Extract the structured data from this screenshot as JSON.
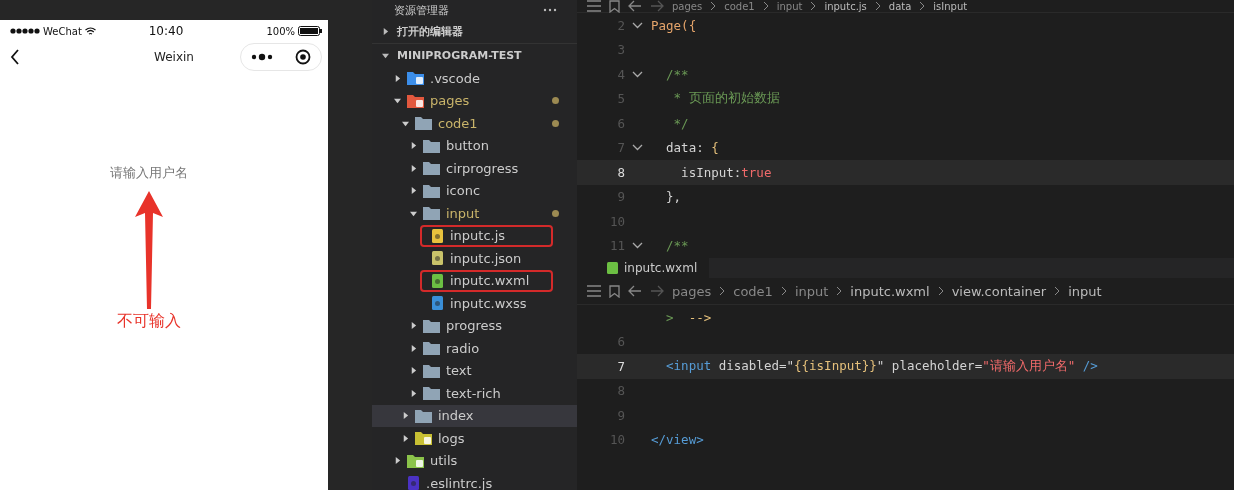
{
  "phone": {
    "status_bar": {
      "carrier": "WeChat",
      "time": "10:40",
      "battery": "100%"
    },
    "nav_bar": {
      "title": "Weixin"
    },
    "input": {
      "placeholder": "请输入用户名",
      "disabled": true
    },
    "annotation": "不可输入"
  },
  "explorer": {
    "title": "资源管理器",
    "sections": [
      {
        "label": "打开的编辑器",
        "expanded": false
      },
      {
        "label": "MINIPROGRAM-TEST",
        "expanded": true
      }
    ],
    "tree": [
      {
        "label": ".vscode",
        "kind": "vscode",
        "expanded": false,
        "modified": false,
        "selected": false
      },
      {
        "label": "pages",
        "kind": "pages",
        "expanded": true,
        "modified": true,
        "selected": false,
        "children": [
          {
            "label": "code1",
            "kind": "folder",
            "expanded": true,
            "modified": true,
            "selected": false,
            "children": [
              {
                "label": "button",
                "kind": "folder",
                "expanded": false,
                "modified": false,
                "selected": false
              },
              {
                "label": "cirprogress",
                "kind": "folder",
                "expanded": false,
                "modified": false,
                "selected": false
              },
              {
                "label": "iconc",
                "kind": "folder",
                "expanded": false,
                "modified": false,
                "selected": false
              },
              {
                "label": "input",
                "kind": "folder",
                "expanded": true,
                "modified": true,
                "selected": false,
                "children": [
                  {
                    "label": "inputc.js",
                    "kind": "js",
                    "boxed": true,
                    "modified": false,
                    "selected": false
                  },
                  {
                    "label": "inputc.json",
                    "kind": "json",
                    "boxed": false,
                    "modified": false,
                    "selected": false
                  },
                  {
                    "label": "inputc.wxml",
                    "kind": "wxml",
                    "boxed": true,
                    "modified": false,
                    "selected": false
                  },
                  {
                    "label": "inputc.wxss",
                    "kind": "wxss",
                    "boxed": false,
                    "modified": false,
                    "selected": false
                  }
                ]
              },
              {
                "label": "progress",
                "kind": "folder",
                "expanded": false,
                "modified": false,
                "selected": false
              },
              {
                "label": "radio",
                "kind": "folder",
                "expanded": false,
                "modified": false,
                "selected": false
              },
              {
                "label": "text",
                "kind": "folder",
                "expanded": false,
                "modified": false,
                "selected": false
              },
              {
                "label": "text-rich",
                "kind": "folder",
                "expanded": false,
                "modified": false,
                "selected": false
              }
            ]
          },
          {
            "label": "index",
            "kind": "folder",
            "expanded": false,
            "modified": false,
            "selected": true
          },
          {
            "label": "logs",
            "kind": "logs",
            "expanded": false,
            "modified": false,
            "selected": false
          }
        ]
      },
      {
        "label": "utils",
        "kind": "utils",
        "expanded": false,
        "modified": false,
        "selected": false
      },
      {
        "label": ".eslintrc.js",
        "kind": "eslint",
        "modified": false,
        "selected": false
      }
    ]
  },
  "editors": [
    {
      "breadcrumb": [
        "pages",
        "code1",
        "input",
        "inputc.js",
        "data",
        "isInput"
      ],
      "lines": [
        {
          "number": "2",
          "fold": true,
          "current": false,
          "tokens": [
            {
              "text": "Page({",
              "kind": "func"
            }
          ]
        },
        {
          "number": "3",
          "fold": false,
          "current": false
        },
        {
          "number": "4",
          "fold": true,
          "current": false,
          "tokens": [
            {
              "text": "  /**",
              "kind": "comment"
            }
          ]
        },
        {
          "number": "5",
          "fold": false,
          "current": false,
          "tokens": [
            {
              "text": "   * 页面的初始数据",
              "kind": "comment"
            }
          ]
        },
        {
          "number": "6",
          "fold": false,
          "current": false,
          "tokens": [
            {
              "text": "   */",
              "kind": "comment"
            }
          ]
        },
        {
          "number": "7",
          "fold": true,
          "current": false,
          "tokens": [
            {
              "text": "  data: ",
              "kind": "plain"
            },
            {
              "text": "{",
              "kind": "brace"
            }
          ]
        },
        {
          "number": "8",
          "fold": false,
          "current": true,
          "tokens": [
            {
              "text": "    isInput:",
              "kind": "plain"
            },
            {
              "text": "true",
              "kind": "bool"
            }
          ]
        },
        {
          "number": "9",
          "fold": false,
          "current": false,
          "tokens": [
            {
              "text": "  },",
              "kind": "plain"
            }
          ]
        },
        {
          "number": "10",
          "fold": false,
          "current": false
        },
        {
          "number": "11",
          "fold": true,
          "current": false,
          "tokens": [
            {
              "text": "  /**",
              "kind": "comment"
            }
          ]
        }
      ]
    },
    {
      "tab": "inputc.wxml",
      "breadcrumb": [
        "pages",
        "code1",
        "input",
        "inputc.wxml",
        "view.container",
        "input"
      ],
      "lines": [
        {
          "fold": false,
          "current": false,
          "tokens": [
            {
              "text": "  >",
              "kind": "comment"
            },
            {
              "text": "  -->",
              "kind": "brace"
            }
          ]
        },
        {
          "number": "6",
          "fold": false,
          "current": false
        },
        {
          "number": "7",
          "fold": false,
          "current": true,
          "tokens": [
            {
              "text": "  <input",
              "kind": "tag"
            },
            {
              "text": " disabled=\"",
              "kind": "plain"
            },
            {
              "text": "{{isInput}}",
              "kind": "brace"
            },
            {
              "text": "\" placeholder=",
              "kind": "plain"
            },
            {
              "text": "\"请输入用户名\"",
              "kind": "string"
            },
            {
              "text": " />",
              "kind": "tag"
            }
          ]
        },
        {
          "number": "8",
          "fold": false,
          "current": false
        },
        {
          "number": "9",
          "fold": false,
          "current": false
        },
        {
          "number": "10",
          "fold": false,
          "current": false,
          "tokens": [
            {
              "text": "</view>",
              "kind": "tag"
            }
          ]
        }
      ]
    }
  ]
}
